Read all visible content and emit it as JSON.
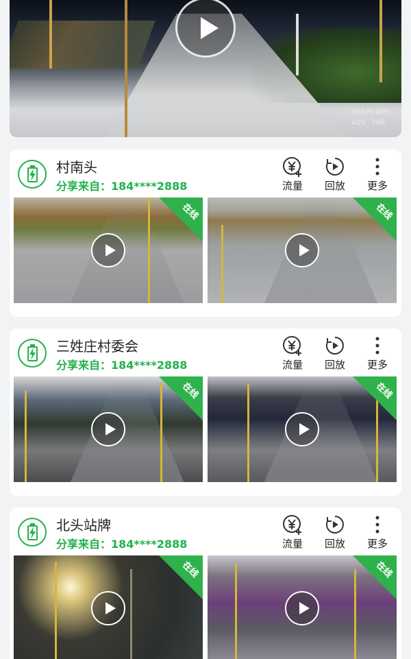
{
  "top_video": {
    "osd_line1": "HDIPCAMS",
    "osd_line2": "AOV_3AR"
  },
  "devices": [
    {
      "name": "村南头",
      "share_from": "分享来自：184****2888",
      "actions": [
        {
          "label": "流量",
          "icon": "yuan-plus-icon"
        },
        {
          "label": "回放",
          "icon": "replay-icon"
        },
        {
          "label": "更多",
          "icon": "more-vertical-icon"
        }
      ],
      "cameras": [
        {
          "status": "在线"
        },
        {
          "status": "在线"
        }
      ]
    },
    {
      "name": "三姓庄村委会",
      "share_from": "分享来自：184****2888",
      "actions": [
        {
          "label": "流量",
          "icon": "yuan-plus-icon"
        },
        {
          "label": "回放",
          "icon": "replay-icon"
        },
        {
          "label": "更多",
          "icon": "more-vertical-icon"
        }
      ],
      "cameras": [
        {
          "status": "在线"
        },
        {
          "status": "在线"
        }
      ]
    },
    {
      "name": "北头站牌",
      "share_from": "分享来自：184****2888",
      "actions": [
        {
          "label": "流量",
          "icon": "yuan-plus-icon"
        },
        {
          "label": "回放",
          "icon": "replay-icon"
        },
        {
          "label": "更多",
          "icon": "more-vertical-icon"
        }
      ],
      "cameras": [
        {
          "status": "在线"
        },
        {
          "status": "在线"
        }
      ]
    }
  ],
  "colors": {
    "accent_green": "#23b14d",
    "online_ribbon": "#2fb14c",
    "page_bg": "#f2f3f5"
  }
}
